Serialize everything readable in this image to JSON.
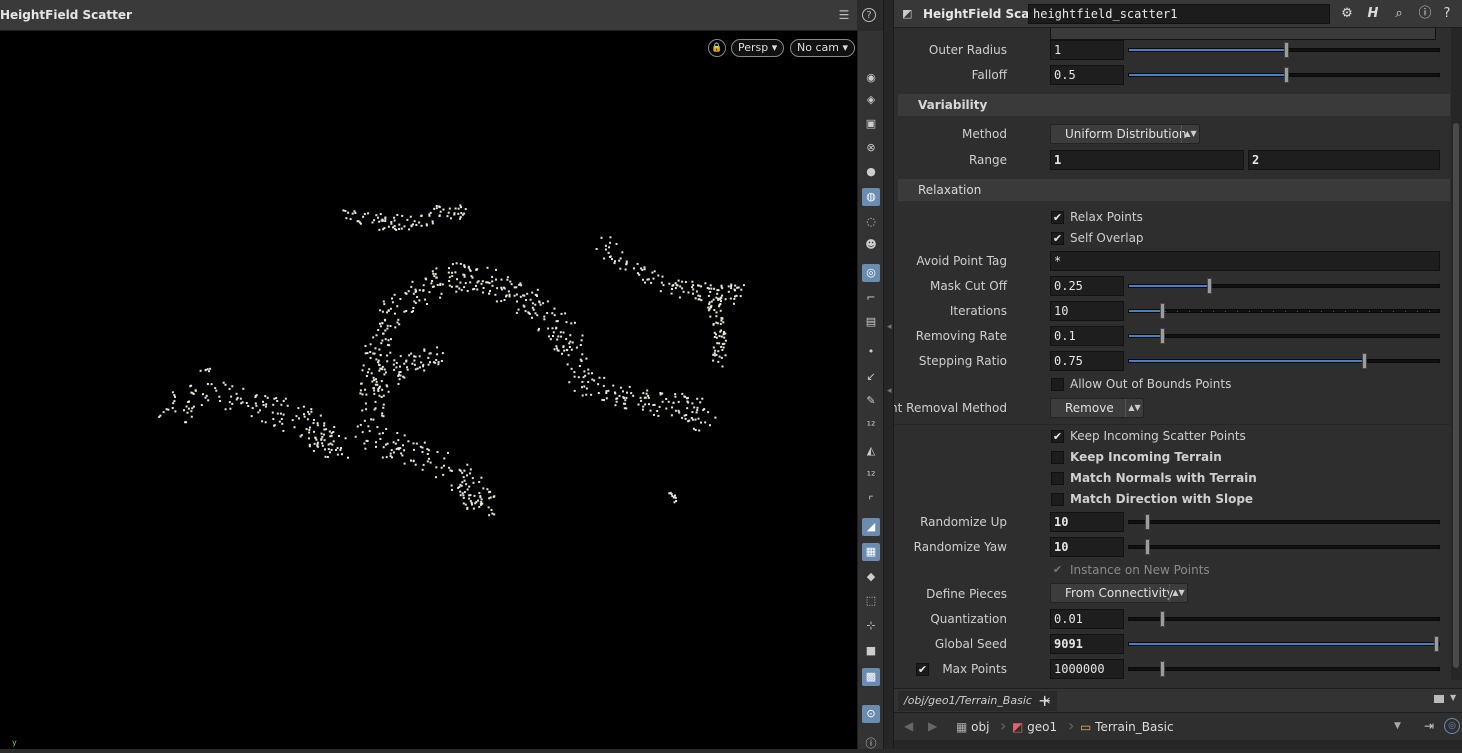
{
  "viewport": {
    "title": "HeightField Scatter",
    "camera_label": "Persp",
    "cam_menu_label": "No cam",
    "axis_label": "y"
  },
  "param_pane": {
    "node_type": "HeightField Scatter",
    "node_name": "heightfield_scatter1",
    "rows": {
      "outer_radius": {
        "label": "Outer Radius",
        "value": "1",
        "fraction": 0.5
      },
      "falloff": {
        "label": "Falloff",
        "value": "0.5",
        "fraction": 0.5
      }
    },
    "variability": {
      "title": "Variability",
      "method_label": "Method",
      "method_value": "Uniform Distribution",
      "range_label": "Range",
      "range_min": "1",
      "range_max": "2"
    },
    "relaxation": {
      "title": "Relaxation",
      "relax_points": {
        "label": "Relax Points",
        "checked": true
      },
      "self_overlap": {
        "label": "Self Overlap",
        "checked": true
      },
      "avoid_point_tag": {
        "label": "Avoid Point Tag",
        "value": "*"
      },
      "mask_cut_off": {
        "label": "Mask Cut Off",
        "value": "0.25",
        "fraction": 0.25
      },
      "iterations": {
        "label": "Iterations",
        "value": "10",
        "fraction": 0.1
      },
      "removing_rate": {
        "label": "Removing Rate",
        "value": "0.1",
        "fraction": 0.1
      },
      "stepping_ratio": {
        "label": "Stepping Ratio",
        "value": "0.75",
        "fraction": 0.75
      },
      "allow_out_of_bounds": {
        "label": "Allow Out of Bounds Points",
        "checked": false
      },
      "point_removal_method_label": "Point Removal Method",
      "point_removal_method_value": "Remove"
    },
    "output": {
      "keep_incoming_scatter": {
        "label": "Keep Incoming Scatter Points",
        "checked": true
      },
      "keep_incoming_terrain": {
        "label": "Keep Incoming Terrain",
        "checked": false
      },
      "match_normals": {
        "label": "Match Normals with Terrain",
        "checked": false
      },
      "match_direction": {
        "label": "Match Direction with Slope",
        "checked": false
      },
      "randomize_up": {
        "label": "Randomize Up",
        "value": "10",
        "fraction": 0.05
      },
      "randomize_yaw": {
        "label": "Randomize Yaw",
        "value": "10",
        "fraction": 0.05
      },
      "instance_on_new_points": {
        "label": "Instance on New Points",
        "checked": true
      },
      "define_pieces_label": "Define Pieces",
      "define_pieces_value": "From Connectivity",
      "quantization": {
        "label": "Quantization",
        "value": "0.01",
        "fraction": 0.1
      },
      "global_seed": {
        "label": "Global Seed",
        "value": "9091",
        "fraction": 1.0
      },
      "max_points": {
        "label": "Max Points",
        "value": "1000000",
        "fraction": 0.1
      }
    }
  },
  "network": {
    "tab_label": "/obj/geo1/Terrain_Basic",
    "tab_close": "×",
    "add_tab": "+",
    "crumbs": [
      "obj",
      "geo1",
      "Terrain_Basic"
    ]
  },
  "colors": {
    "accent": "#4a7fc1",
    "points": "#e8e8d8",
    "viewport_bg": "#000000"
  }
}
